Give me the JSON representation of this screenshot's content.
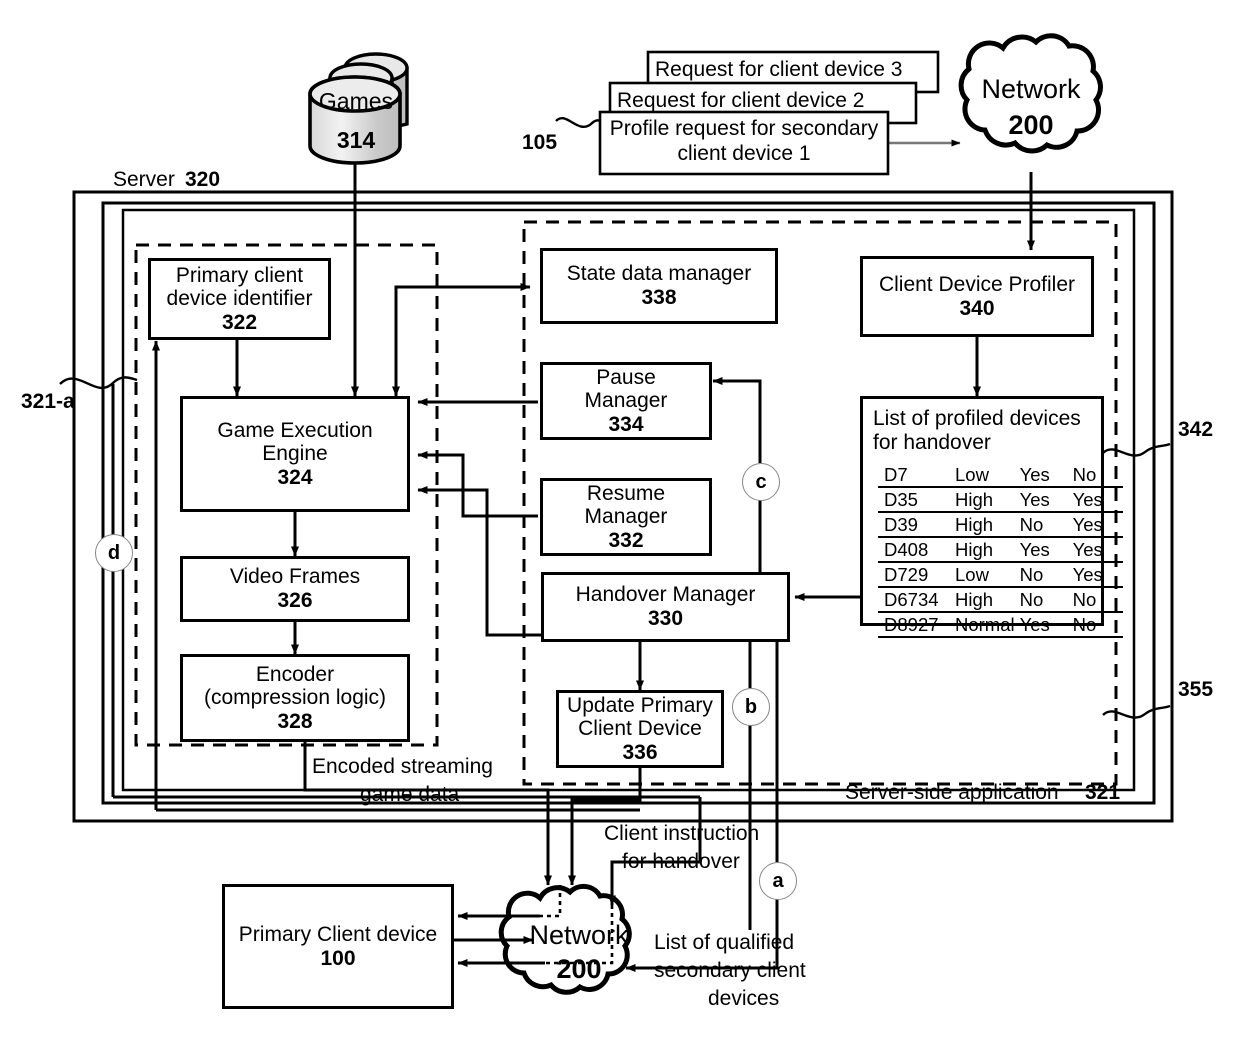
{
  "figure": {
    "server_label": "Server",
    "server_num": "320",
    "server_side_app_label": "Server-side application",
    "server_side_app_num": "321",
    "ref_321a": "321-a",
    "ref_342": "342",
    "ref_355": "355",
    "ref_105": "105"
  },
  "datastore": {
    "label": "Games",
    "num": "314"
  },
  "requests": [
    {
      "text": "Request for client device 3"
    },
    {
      "text": "Request for client device 2"
    },
    {
      "text": "Profile request for secondary client device 1"
    }
  ],
  "clouds": {
    "top": {
      "name": "Network",
      "num": "200"
    },
    "bottom": {
      "name": "Network",
      "num": "200"
    }
  },
  "blocks": {
    "primary_client_device_identifier": {
      "line1": "Primary client",
      "line2": "device identifier",
      "num": "322"
    },
    "game_execution_engine": {
      "line1": "Game Execution",
      "line2": "Engine",
      "num": "324"
    },
    "video_frames": {
      "line1": "Video Frames",
      "num": "326"
    },
    "encoder": {
      "line1": "Encoder",
      "line2": "(compression logic)",
      "num": "328"
    },
    "state_data_manager": {
      "line1": "State data manager",
      "num": "338"
    },
    "pause_manager": {
      "line1": "Pause",
      "line2": "Manager",
      "num": "334"
    },
    "resume_manager": {
      "line1": "Resume",
      "line2": "Manager",
      "num": "332"
    },
    "handover_manager": {
      "line1": "Handover Manager",
      "num": "330"
    },
    "update_primary_client_device": {
      "line1": "Update Primary",
      "line2": "Client Device",
      "num": "336"
    },
    "client_device_profiler": {
      "line1": "Client Device Profiler",
      "num": "340"
    },
    "primary_client_device": {
      "line1": "Primary Client device",
      "num": "100"
    }
  },
  "profiled_devices": {
    "title_line1": "List of profiled devices",
    "title_line2": "for handover",
    "rows": [
      [
        "D7",
        "Low",
        "Yes",
        "No"
      ],
      [
        "D35",
        "High",
        "Yes",
        "Yes"
      ],
      [
        "D39",
        "High",
        "No",
        "Yes"
      ],
      [
        "D408",
        "High",
        "Yes",
        "Yes"
      ],
      [
        "D729",
        "Low",
        "No",
        "Yes"
      ],
      [
        "D6734",
        "High",
        "No",
        "No"
      ],
      [
        "D8927",
        "Normal",
        "Yes",
        "No"
      ]
    ]
  },
  "markers": {
    "a": "a",
    "b": "b",
    "c": "c",
    "d": "d"
  },
  "flow_labels": {
    "encoded_stream": "Encoded streaming\ngame data",
    "encoded_stream_l1": "Encoded streaming",
    "encoded_stream_l2": "game data",
    "client_instruction_l1": "Client instruction",
    "client_instruction_l2": "for handover",
    "qualified_list_l1": "List of qualified",
    "qualified_list_l2": "secondary client",
    "qualified_list_l3": "devices"
  }
}
